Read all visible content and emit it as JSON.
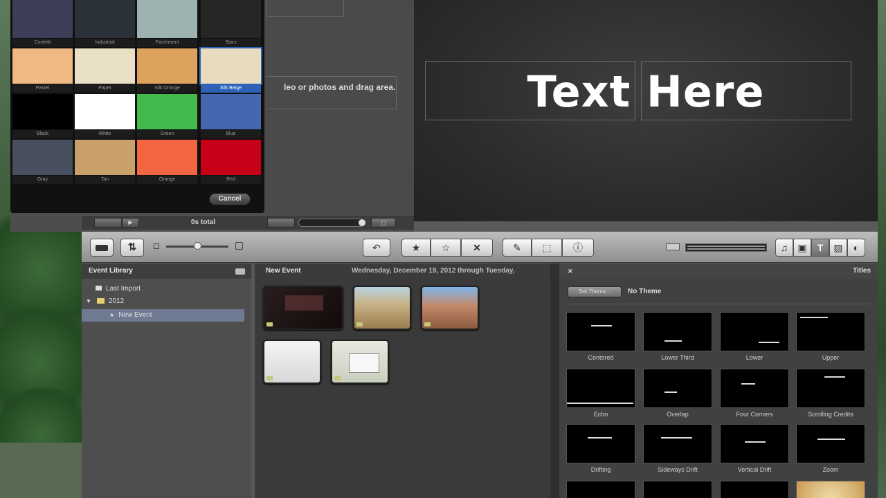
{
  "project": {
    "hint": "leo or photos and drag area.",
    "total_label": "0s total",
    "play_label": "▶",
    "fullscreen_label": "◻"
  },
  "backgrounds": {
    "items": [
      {
        "label": "Confetti",
        "color": "#3d3f58"
      },
      {
        "label": "Industrial",
        "color": "#2b3138"
      },
      {
        "label": "Parchment",
        "color": "#9fb2b2"
      },
      {
        "label": "Stars",
        "color": "#262626"
      },
      {
        "label": "Pastel",
        "color": "#f0b983"
      },
      {
        "label": "Paper",
        "color": "#e8dfc4"
      },
      {
        "label": "Silk Orange",
        "color": "#dda25e"
      },
      {
        "label": "Silk Beige",
        "color": "#e8dbbe"
      },
      {
        "label": "Black",
        "color": "#000000"
      },
      {
        "label": "White",
        "color": "#ffffff"
      },
      {
        "label": "Green",
        "color": "#44b94c"
      },
      {
        "label": "Blue",
        "color": "#4467b0"
      },
      {
        "label": "Gray",
        "color": "#48505f"
      },
      {
        "label": "Tan",
        "color": "#c9a06a"
      },
      {
        "label": "Orange",
        "color": "#f46542"
      },
      {
        "label": "Red",
        "color": "#c70017"
      }
    ],
    "cancel_label": "Cancel"
  },
  "viewer": {
    "title_text": "Text Here"
  },
  "toolbar": {
    "import_icon": "camera-import-icon",
    "swap_icon": "swap-arrows-icon",
    "undo_icon": "↶",
    "favorite_icon": "★",
    "unmark_icon": "☆",
    "reject_icon": "✕",
    "dropper_icon": "✎",
    "crop_icon": "⬚",
    "info_icon": "ⓘ",
    "music_icon": "♫",
    "photo_icon": "▣",
    "titles_icon": "T",
    "transitions_icon": "▨",
    "maps_icon": "◐"
  },
  "library": {
    "header": "Event Library",
    "items": [
      "Last Import",
      "2012",
      "New Event"
    ]
  },
  "events": {
    "title": "New Event",
    "date_range": "Wednesday, December 19, 2012 through Tuesday,"
  },
  "titles": {
    "header": "Titles",
    "theme_button": "Set Theme...",
    "no_theme": "No Theme",
    "tiles": [
      "Centered",
      "Lower Third",
      "Lower",
      "Upper",
      "Echo",
      "Overlap",
      "Four Corners",
      "Scrolling Credits",
      "Drifting",
      "Sideways Drift",
      "Vertical Drift",
      "Zoom"
    ]
  }
}
